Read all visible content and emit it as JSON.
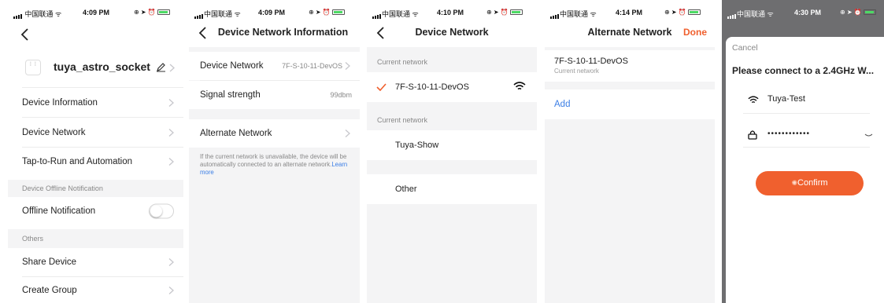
{
  "status_bars": [
    {
      "carrier": "中国联通",
      "time": "4:09 PM"
    },
    {
      "carrier": "中国联通",
      "time": "4:09 PM"
    },
    {
      "carrier": "中国联通",
      "time": "4:10 PM"
    },
    {
      "carrier": "中国联通",
      "time": "4:14 PM"
    },
    {
      "carrier": "中国联通",
      "time": "4:30 PM"
    }
  ],
  "device_settings": {
    "device_name": "tuya_astro_socket",
    "items": [
      {
        "label": "Device Information"
      },
      {
        "label": "Device Network"
      },
      {
        "label": "Tap-to-Run and Automation"
      }
    ],
    "offline_section": "Device Offline Notification",
    "offline_label": "Offline Notification",
    "offline_enabled": false,
    "others_section": "Others",
    "others_items": [
      {
        "label": "Share Device"
      },
      {
        "label": "Create Group"
      }
    ]
  },
  "network_info": {
    "title": "Device Network Information",
    "device_network_label": "Device Network",
    "device_network_value": "7F-S-10-11-DevOS",
    "signal_label": "Signal strength",
    "signal_value": "99dbm",
    "alternate_label": "Alternate Network",
    "note_text": "If the current network is unavailable, the device will be automatically connected to an alternate network.",
    "note_link": "Learn more"
  },
  "device_network": {
    "title": "Device Network",
    "section1": "Current network",
    "current_ssid": "7F-S-10-11-DevOS",
    "section2": "Current network",
    "other_ssid": "Tuya-Show",
    "other_label": "Other"
  },
  "alternate_network": {
    "title": "Alternate Network",
    "done_label": "Done",
    "ssid": "7F-S-10-11-DevOS",
    "ssid_sub": "Current network",
    "add_label": "Add"
  },
  "connect_sheet": {
    "cancel_label": "Cancel",
    "heading": "Please connect to a 2.4GHz W...",
    "ssid": "Tuya-Test",
    "password_mask": "••••••••••••",
    "confirm_label": "Confirm"
  },
  "colors": {
    "accent": "#f0602e",
    "link": "#3b7ee5",
    "check": "#f0602e"
  }
}
